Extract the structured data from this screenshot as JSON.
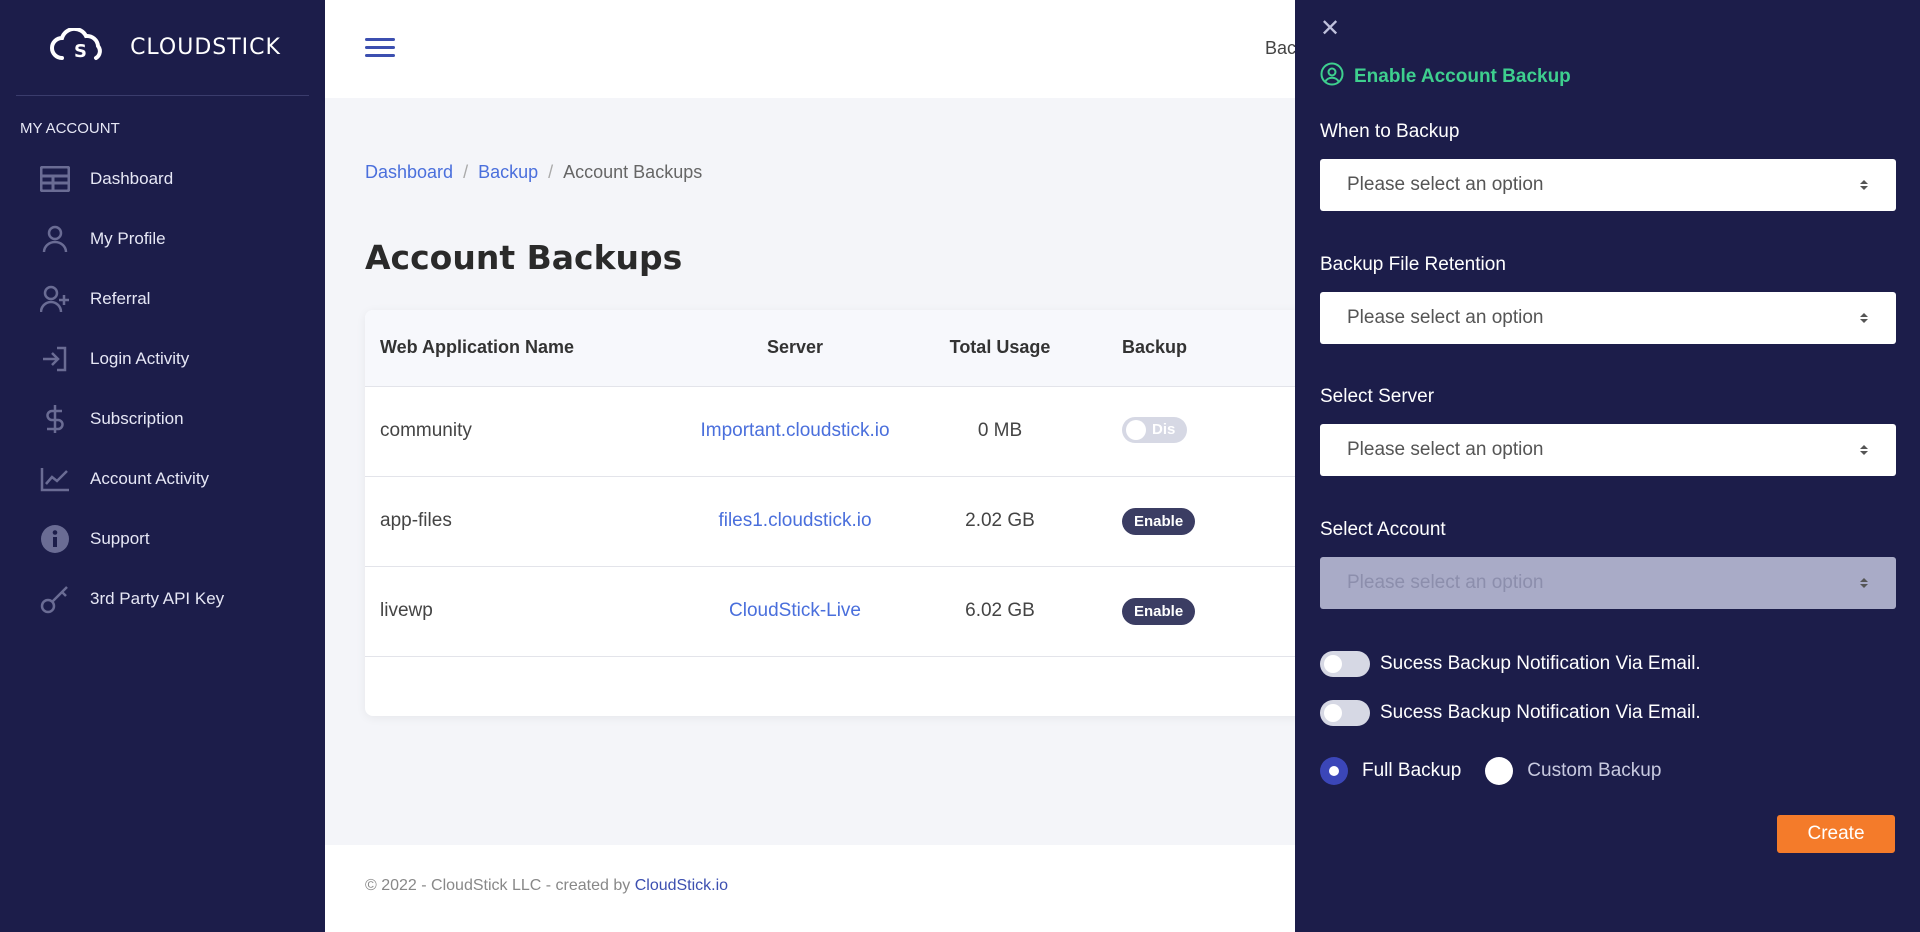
{
  "brand": {
    "name": "CLOUDSTICK"
  },
  "sidebar": {
    "section_title": "MY ACCOUNT",
    "items": [
      {
        "label": "Dashboard",
        "icon": "dashboard-icon"
      },
      {
        "label": "My Profile",
        "icon": "user-icon"
      },
      {
        "label": "Referral",
        "icon": "user-plus-icon"
      },
      {
        "label": "Login Activity",
        "icon": "login-icon"
      },
      {
        "label": "Subscription",
        "icon": "dollar-icon"
      },
      {
        "label": "Account Activity",
        "icon": "chart-icon"
      },
      {
        "label": "Support",
        "icon": "info-icon"
      },
      {
        "label": "3rd Party API Key",
        "icon": "key-icon"
      }
    ]
  },
  "topbar": {
    "partial_text": "Bac"
  },
  "breadcrumb": {
    "dashboard": "Dashboard",
    "backup": "Backup",
    "current": "Account Backups"
  },
  "page": {
    "title": "Account Backups"
  },
  "table": {
    "headers": [
      "Web Application Name",
      "Server",
      "Total Usage",
      "Backup"
    ],
    "rows": [
      {
        "name": "community",
        "server": "Important.cloudstick.io",
        "usage": "0 MB",
        "status": "Dis"
      },
      {
        "name": "app-files",
        "server": "files1.cloudstick.io",
        "usage": "2.02 GB",
        "status": "Enable"
      },
      {
        "name": "livewp",
        "server": "CloudStick-Live",
        "usage": "6.02 GB",
        "status": "Enable"
      }
    ]
  },
  "footer": {
    "text": "© 2022 - CloudStick LLC - created by ",
    "link": "CloudStick.io"
  },
  "drawer": {
    "title": "Enable Account Backup",
    "fields": [
      {
        "label": "When to Backup",
        "placeholder": "Please select an option"
      },
      {
        "label": "Backup File Retention",
        "placeholder": "Please select an option"
      },
      {
        "label": "Select Server",
        "placeholder": "Please select an option"
      },
      {
        "label": "Select Account",
        "placeholder": "Please select an option"
      }
    ],
    "toggles": [
      {
        "label": "Sucess Backup Notification Via Email."
      },
      {
        "label": "Sucess Backup Notification Via Email."
      }
    ],
    "radios": [
      {
        "label": "Full Backup",
        "selected": true
      },
      {
        "label": "Custom Backup",
        "selected": false
      }
    ],
    "create_label": "Create"
  },
  "colors": {
    "sidebar_bg": "#1c1d4a",
    "accent_green": "#3ecf8e",
    "create_orange": "#f47b2a",
    "link_blue": "#4a6fdc"
  }
}
